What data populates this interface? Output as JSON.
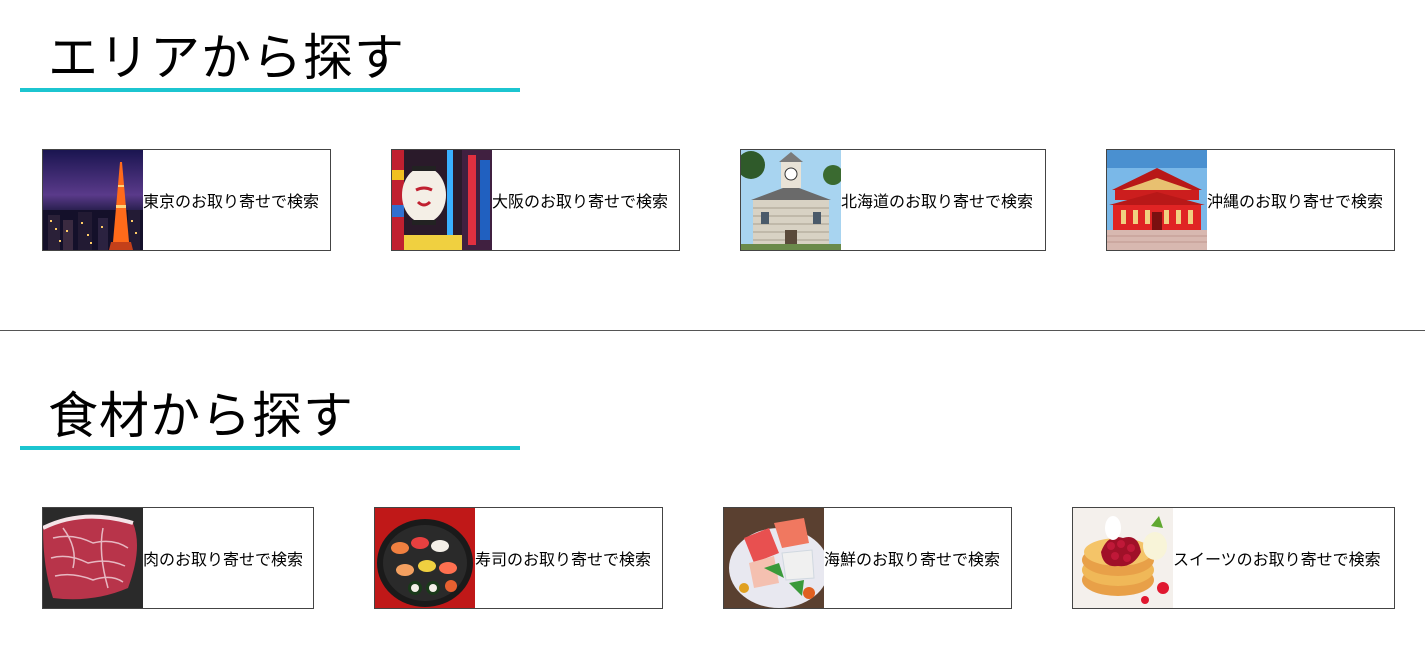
{
  "area_section": {
    "title": "エリアから探す",
    "cards": [
      {
        "label": "東京のお取り寄せで検索",
        "image": "tokyo-tower-night-photo"
      },
      {
        "label": "大阪のお取り寄せで検索",
        "image": "osaka-dotonbori-lantern-photo"
      },
      {
        "label": "北海道のお取り寄せで検索",
        "image": "sapporo-clock-tower-photo"
      },
      {
        "label": "沖縄のお取り寄せで検索",
        "image": "shuri-castle-photo"
      }
    ]
  },
  "food_section": {
    "title": "食材から探す",
    "cards": [
      {
        "label": "肉のお取り寄せで検索",
        "image": "marbled-beef-photo"
      },
      {
        "label": "寿司のお取り寄せで検索",
        "image": "sushi-platter-photo"
      },
      {
        "label": "海鮮のお取り寄せで検索",
        "image": "sashimi-seafood-photo"
      },
      {
        "label": "スイーツのお取り寄せで検索",
        "image": "pancake-dessert-photo"
      }
    ]
  },
  "colors": {
    "heading_underline": "#1cc5d0",
    "card_border": "#444444",
    "divider": "#555555"
  }
}
